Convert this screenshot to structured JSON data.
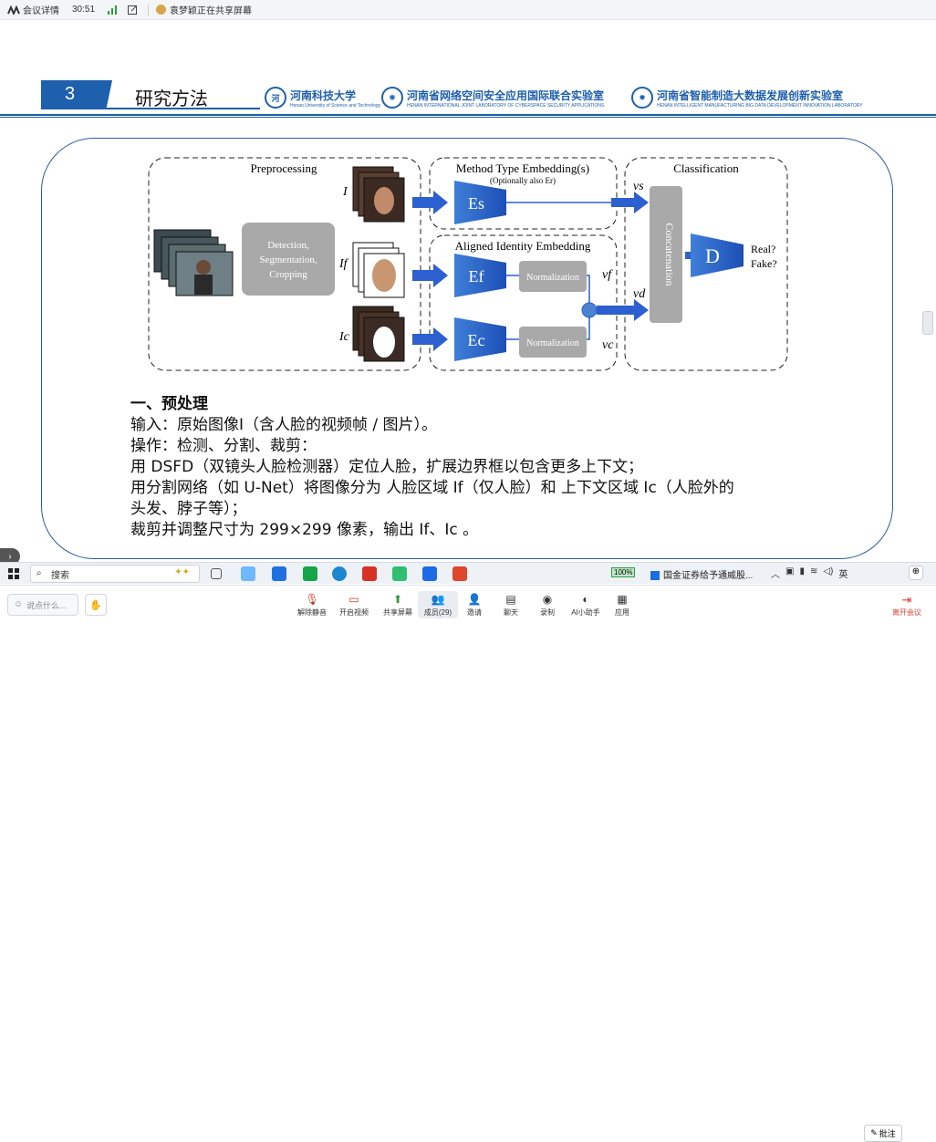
{
  "topbar": {
    "meeting_details": "会议详情",
    "timer": "30:51",
    "sharing_notice": "袁梦颖正在共享屏幕"
  },
  "slide": {
    "section_number": "3",
    "section_title": "研究方法",
    "logos": [
      {
        "name": "河南科技大学",
        "sub": "Henan University of Science and Technology"
      },
      {
        "name": "河南省网络空间安全应用国际联合实验室",
        "sub": "HENAN INTERNATIONAL JOINT LABORATORY OF CYBERSPACE SECURITY APPLICATIONS"
      },
      {
        "name": "河南省智能制造大数据发展创新实验室",
        "sub": "HENAN INTELLIGENT MANUFACTURING BIG DATA DEVELOPMENT INNOVATION LABORATORY"
      }
    ],
    "diagram": {
      "preprocessing": "Preprocessing",
      "method_embedding": "Method Type Embedding(s)",
      "method_embedding_sub": "(Optionally also Er)",
      "aligned_identity": "Aligned Identity Embedding",
      "classification": "Classification",
      "detection_l1": "Detection,",
      "detection_l2": "Segmentation,",
      "detection_l3": "Cropping",
      "label_I": "I",
      "label_If": "If",
      "label_Ic": "Ic",
      "es": "Es",
      "ef": "Ef",
      "ec": "Ec",
      "normalization": "Normalization",
      "vs": "vs",
      "vf": "vf",
      "vd": "vd",
      "vc": "vc",
      "concatenation": "Concatenation",
      "d": "D",
      "real": "Real?",
      "fake": "Fake?"
    },
    "text": {
      "heading": "一、预处理",
      "line1": "输入：原始图像I（含人脸的视频帧 / 图片）。",
      "line2": "操作：检测、分割、裁剪：",
      "line3": "用 DSFD（双镜头人脸检测器）定位人脸，扩展边界框以包含更多上下文；",
      "line4": "用分割网络（如 U-Net）将图像分为 人脸区域 If（仅人脸）和 上下文区域 Ic（人脸外的",
      "line5": "头发、脖子等）；",
      "line6": "裁剪并调整尺寸为 299×299 像素，输出 If、Ic 。"
    }
  },
  "taskbar": {
    "search_placeholder": "搜索",
    "battery": "100%",
    "notification": "国金证券给予通威股...",
    "lang": "英",
    "annotate": "批注"
  },
  "bottombar": {
    "chat_placeholder": "说点什么...",
    "items": [
      {
        "label": "解除静音",
        "icon": "mic-off-icon"
      },
      {
        "label": "开启视频",
        "icon": "video-off-icon"
      },
      {
        "label": "共享屏幕",
        "icon": "share-screen-icon"
      },
      {
        "label": "成员(29)",
        "icon": "members-icon"
      },
      {
        "label": "邀请",
        "icon": "invite-icon"
      },
      {
        "label": "聊天",
        "icon": "chat-icon"
      },
      {
        "label": "录制",
        "icon": "record-icon"
      },
      {
        "label": "AI小助手",
        "icon": "ai-assistant-icon"
      },
      {
        "label": "应用",
        "icon": "apps-icon"
      }
    ],
    "leave": "离开会议"
  },
  "colors": {
    "brand_blue": "#1e5fae",
    "arrow_blue": "#2c5fcf",
    "leave_red": "#e23c2f"
  }
}
